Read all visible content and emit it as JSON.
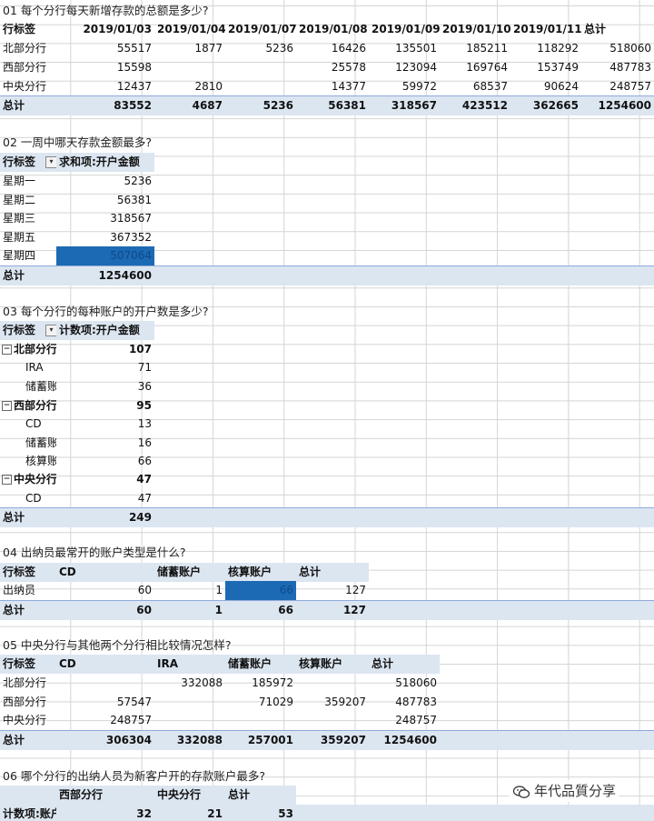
{
  "q1": {
    "title": "01 每个分行每天新增存款的总额是多少?",
    "headers": [
      "行标签",
      "2019/01/03",
      "2019/01/04",
      "2019/01/07",
      "2019/01/08",
      "2019/01/09",
      "2019/01/10",
      "2019/01/11",
      "总计"
    ],
    "rows": [
      [
        "北部分行",
        "55517",
        "1877",
        "5236",
        "16426",
        "135501",
        "185211",
        "118292",
        "518060"
      ],
      [
        "西部分行",
        "15598",
        "",
        "",
        "25578",
        "123094",
        "169764",
        "153749",
        "487783"
      ],
      [
        "中央分行",
        "12437",
        "2810",
        "",
        "14377",
        "59972",
        "68537",
        "90624",
        "248757"
      ]
    ],
    "total": [
      "总计",
      "83552",
      "4687",
      "5236",
      "56381",
      "318567",
      "423512",
      "362665",
      "1254600"
    ]
  },
  "q2": {
    "title": "02 一周中哪天存款金额最多?",
    "headers": [
      "行标签",
      "求和项:开户金额"
    ],
    "rows": [
      [
        "星期一",
        "5236"
      ],
      [
        "星期二",
        "56381"
      ],
      [
        "星期三",
        "318567"
      ],
      [
        "星期五",
        "367352"
      ],
      [
        "星期四",
        "507064"
      ]
    ],
    "total": [
      "总计",
      "1254600"
    ]
  },
  "q3": {
    "title": "03 每个分行的每种账户的开户数是多少?",
    "headers": [
      "行标签",
      "计数项:开户金额"
    ],
    "rows": [
      [
        "北部分行",
        "107"
      ],
      [
        "IRA",
        "71"
      ],
      [
        "储蓄账户",
        "36"
      ],
      [
        "西部分行",
        "95"
      ],
      [
        "CD",
        "13"
      ],
      [
        "储蓄账户",
        "16"
      ],
      [
        "核算账户",
        "66"
      ],
      [
        "中央分行",
        "47"
      ],
      [
        "CD",
        "47"
      ]
    ],
    "total": [
      "总计",
      "249"
    ]
  },
  "q4": {
    "title": "04 出纳员最常开的账户类型是什么?",
    "headers": [
      "行标签",
      "CD",
      "储蓄账户",
      "核算账户",
      "总计"
    ],
    "rows": [
      [
        "出纳员",
        "60",
        "1",
        "66",
        "127"
      ]
    ],
    "total": [
      "总计",
      "60",
      "1",
      "66",
      "127"
    ]
  },
  "q5": {
    "title": "05 中央分行与其他两个分行相比较情况怎样?",
    "headers": [
      "行标签",
      "CD",
      "IRA",
      "储蓄账户",
      "核算账户",
      "总计"
    ],
    "rows": [
      [
        "北部分行",
        "",
        "332088",
        "185972",
        "",
        "518060"
      ],
      [
        "西部分行",
        "57547",
        "",
        "71029",
        "359207",
        "487783"
      ],
      [
        "中央分行",
        "248757",
        "",
        "",
        "",
        "248757"
      ]
    ],
    "total": [
      "总计",
      "306304",
      "332088",
      "257001",
      "359207",
      "1254600"
    ]
  },
  "q6": {
    "title": "06 哪个分行的出纳人员为新客户开的存款账户最多?",
    "headers": [
      "",
      "西部分行",
      "中央分行",
      "总计"
    ],
    "row": [
      "计数项:账户",
      "32",
      "21",
      "53"
    ]
  },
  "ui": {
    "filter_glyph": "▾",
    "collapse_glyph": "−",
    "watermark": "年代品質分享",
    "highlight_color": "#1c6ab3",
    "header_color": "#dce6f1"
  }
}
